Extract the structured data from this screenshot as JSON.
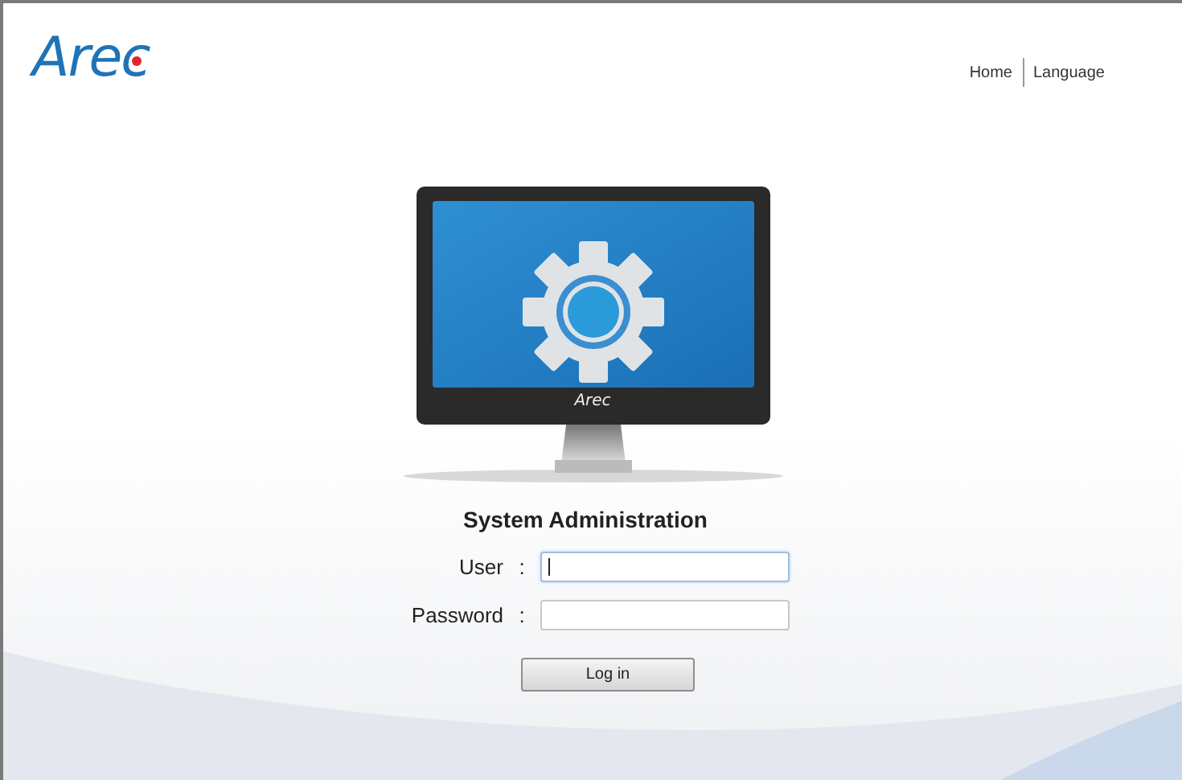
{
  "logo": {
    "text": "Arec"
  },
  "nav": [
    {
      "label": "Home"
    },
    {
      "label": "Language"
    }
  ],
  "monitor": {
    "logo": "Arec"
  },
  "title": "System Administration",
  "fields": [
    {
      "label": "User",
      "separator": ":",
      "focused": true
    },
    {
      "label": "Password",
      "separator": ":",
      "focused": false
    }
  ],
  "button": "Log in"
}
